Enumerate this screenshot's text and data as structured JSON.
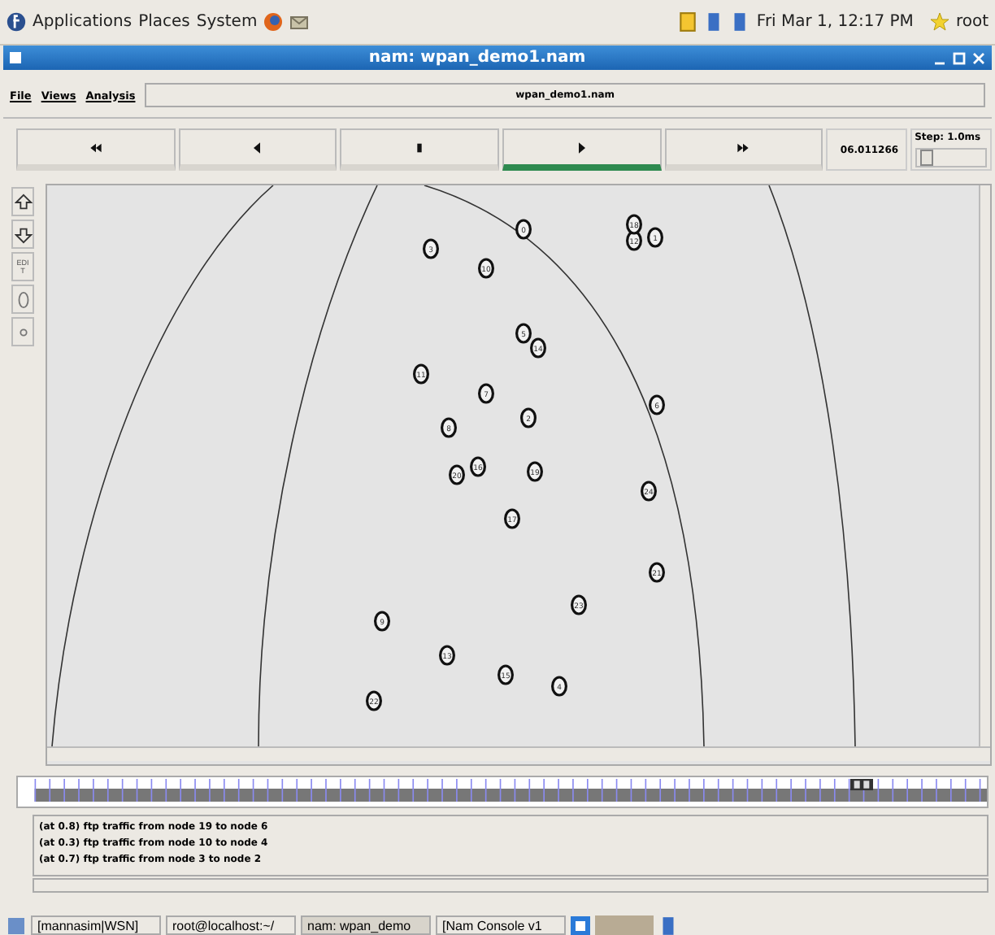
{
  "top_panel": {
    "menus": [
      "Applications",
      "Places",
      "System"
    ],
    "clock": "Fri Mar  1, 12:17 PM",
    "user": "root"
  },
  "window": {
    "title": "nam: wpan_demo1.nam"
  },
  "menu": {
    "items": [
      "File",
      "Views",
      "Analysis"
    ],
    "file_name": "wpan_demo1.nam"
  },
  "controls": [
    {
      "kind": "rewind",
      "selected": false
    },
    {
      "kind": "back",
      "selected": false
    },
    {
      "kind": "stop",
      "selected": false
    },
    {
      "kind": "play",
      "selected": true
    },
    {
      "kind": "forward",
      "selected": false
    }
  ],
  "time": "06.011266",
  "step": {
    "label": "Step: 1.0ms",
    "level": 0.05
  },
  "tools": [
    {
      "kind": "zoom-in"
    },
    {
      "kind": "zoom-out"
    },
    {
      "kind": "text",
      "label": "EDIT"
    },
    {
      "kind": "oval"
    },
    {
      "kind": "dot"
    }
  ],
  "nodes": [
    "0",
    "1",
    "2",
    "3",
    "4",
    "5",
    "6",
    "7",
    "8",
    "9",
    "10",
    "11",
    "12",
    "13",
    "14",
    "15",
    "16",
    "17",
    "18",
    "19",
    "20",
    "21",
    "22",
    "23",
    "24"
  ],
  "log": [
    "(at 0.8) ftp traffic from node 19 to node 6",
    "(at 0.3) ftp traffic from node 10 to node 4",
    "(at 0.7) ftp traffic from node 3 to node 2"
  ],
  "taskbar": [
    {
      "label": "[mannasim|WSN]",
      "selected": false
    },
    {
      "label": "root@localhost:~/",
      "selected": false
    },
    {
      "label": "nam: wpan_demo",
      "selected": true
    },
    {
      "label": "[Nam Console v1",
      "selected": false
    }
  ]
}
